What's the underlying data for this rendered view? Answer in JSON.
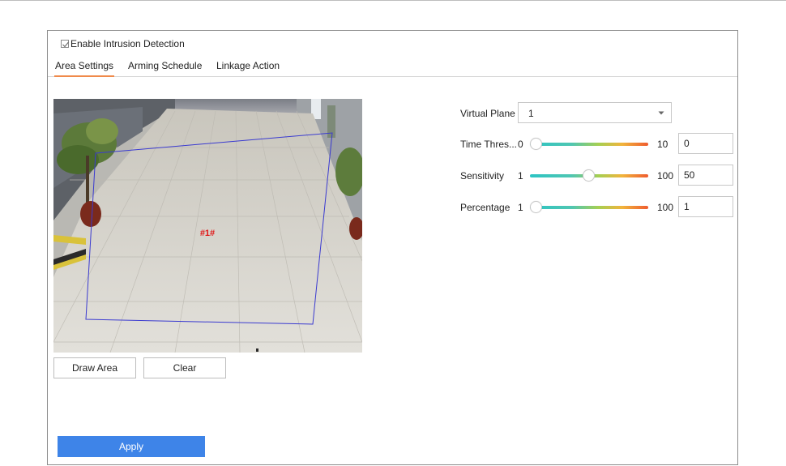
{
  "enable": {
    "label": "Enable Intrusion Detection",
    "checked": true
  },
  "tabs": [
    {
      "label": "Area Settings",
      "active": true
    },
    {
      "label": "Arming Schedule",
      "active": false
    },
    {
      "label": "Linkage Action",
      "active": false
    }
  ],
  "video": {
    "region_label": "#1#"
  },
  "buttons": {
    "draw_area": "Draw Area",
    "clear": "Clear",
    "apply": "Apply"
  },
  "settings": {
    "virtual_plane": {
      "label": "Virtual Plane",
      "value": "1"
    },
    "time_threshold": {
      "label": "Time Thres...",
      "min": "0",
      "max": "10",
      "value": "0"
    },
    "sensitivity": {
      "label": "Sensitivity",
      "min": "1",
      "max": "100",
      "value": "50"
    },
    "percentage": {
      "label": "Percentage",
      "min": "1",
      "max": "100",
      "value": "1"
    }
  },
  "colors": {
    "accent_tab": "#f08a4b",
    "apply_button": "#3e84e8",
    "region_outline": "#3a3ad0",
    "region_label": "#e01818"
  },
  "icons": {
    "checkbox": "checkmark-icon",
    "dropdown": "chevron-down-icon"
  }
}
